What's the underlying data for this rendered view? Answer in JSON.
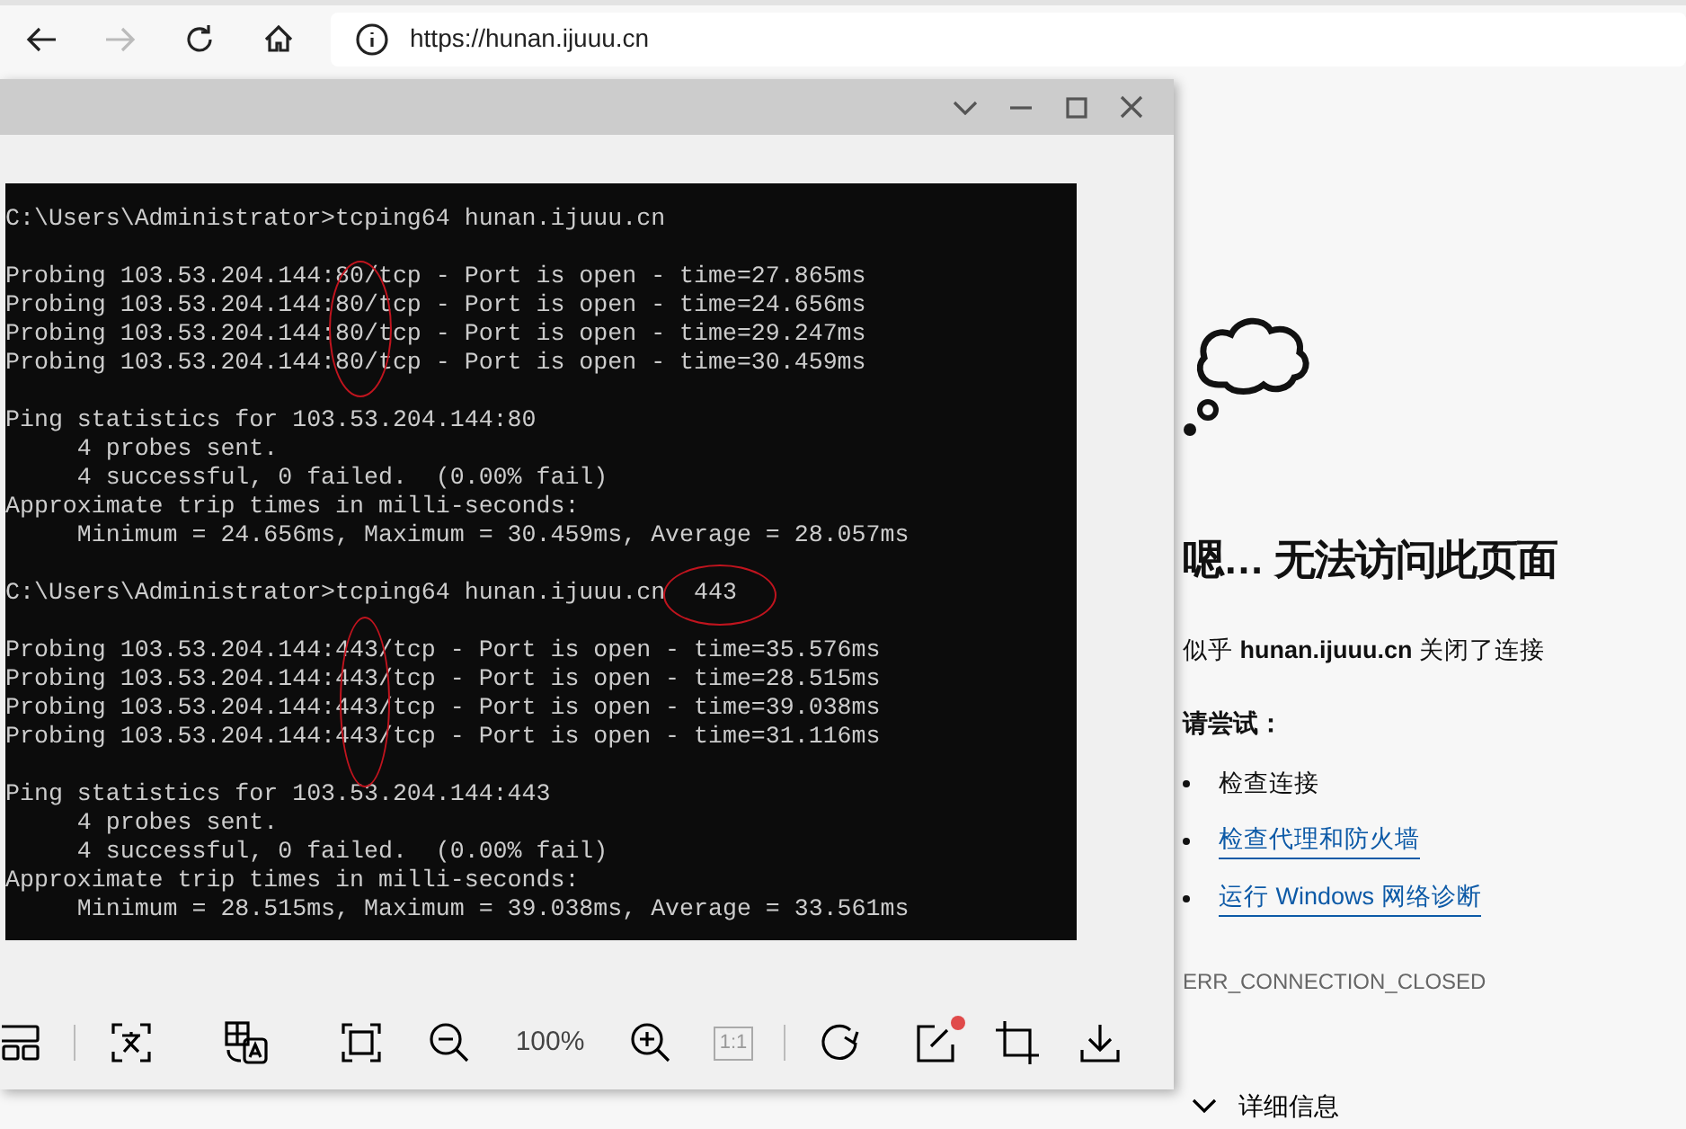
{
  "browser": {
    "address": "https://hunan.ijuuu.cn",
    "forward_disabled": true
  },
  "viewer": {
    "terminal": {
      "blocks": [
        [
          "C:\\Users\\Administrator>tcping64 hunan.ijuuu.cn"
        ],
        [
          "Probing 103.53.204.144:80/tcp - Port is open - time=27.865ms",
          "Probing 103.53.204.144:80/tcp - Port is open - time=24.656ms",
          "Probing 103.53.204.144:80/tcp - Port is open - time=29.247ms",
          "Probing 103.53.204.144:80/tcp - Port is open - time=30.459ms"
        ],
        [
          "Ping statistics for 103.53.204.144:80",
          "     4 probes sent.",
          "     4 successful, 0 failed.  (0.00% fail)",
          "Approximate trip times in milli-seconds:",
          "     Minimum = 24.656ms, Maximum = 30.459ms, Average = 28.057ms"
        ],
        [
          "C:\\Users\\Administrator>tcping64 hunan.ijuuu.cn  443"
        ],
        [
          "Probing 103.53.204.144:443/tcp - Port is open - time=35.576ms",
          "Probing 103.53.204.144:443/tcp - Port is open - time=28.515ms",
          "Probing 103.53.204.144:443/tcp - Port is open - time=39.038ms",
          "Probing 103.53.204.144:443/tcp - Port is open - time=31.116ms"
        ],
        [
          "Ping statistics for 103.53.204.144:443",
          "     4 probes sent.",
          "     4 successful, 0 failed.  (0.00% fail)",
          "Approximate trip times in milli-seconds:",
          "     Minimum = 28.515ms, Maximum = 39.038ms, Average = 33.561ms"
        ]
      ]
    },
    "toolbar": {
      "zoom": "100%",
      "actual_size": {
        "label": "1:1",
        "disabled": true
      },
      "edit_notification": true
    }
  },
  "error_page": {
    "heading": "嗯… 无法访问此页面",
    "message": "似乎 **hunan.ijuuu.cn** 关闭了连接",
    "try_label": "请尝试：",
    "suggestions": [
      {
        "kind": "text",
        "text": "检查连接"
      },
      {
        "kind": "link",
        "text": "检查代理和防火墙"
      },
      {
        "kind": "link",
        "text": "运行 Windows 网络诊断"
      }
    ],
    "error_code": "ERR_CONNECTION_CLOSED",
    "details": {
      "label": "详细信息",
      "expanded": false
    }
  }
}
